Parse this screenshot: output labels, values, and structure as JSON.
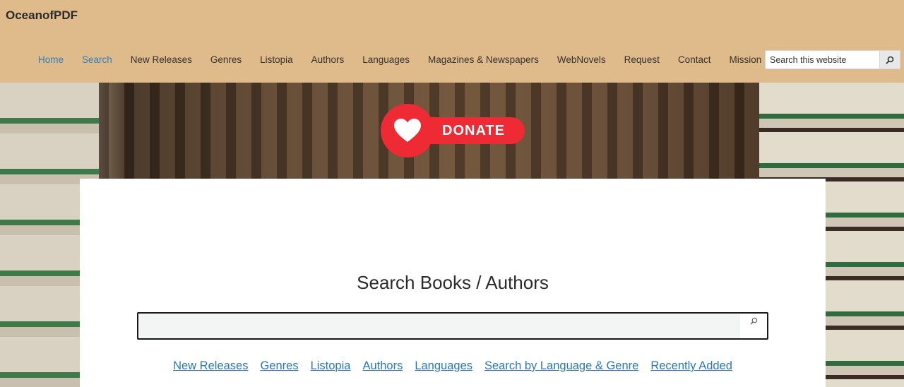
{
  "header": {
    "site_title": "OceanofPDF",
    "background_color": "#dfba8b",
    "nav": [
      {
        "label": "Home",
        "active": true
      },
      {
        "label": "Search",
        "active": true
      },
      {
        "label": "New Releases",
        "active": false
      },
      {
        "label": "Genres",
        "active": false
      },
      {
        "label": "Listopia",
        "active": false
      },
      {
        "label": "Authors",
        "active": false
      },
      {
        "label": "Languages",
        "active": false
      },
      {
        "label": "Magazines & Newspapers",
        "active": false
      },
      {
        "label": "WebNovels",
        "active": false
      },
      {
        "label": "Request",
        "active": false
      },
      {
        "label": "Contact",
        "active": false
      },
      {
        "label": "Mission",
        "active": false
      }
    ],
    "search": {
      "placeholder": "Search this website",
      "icon": "search-icon"
    }
  },
  "donate": {
    "label": "DONATE",
    "icon": "heart-icon",
    "color": "#ee2b34"
  },
  "main": {
    "title": "Search Books / Authors",
    "search": {
      "value": "",
      "icon": "search-icon"
    },
    "links": [
      "New Releases",
      "Genres",
      "Listopia",
      "Authors",
      "Languages",
      "Search by Language & Genre",
      "Recently Added"
    ],
    "link_color": "#2a78b3"
  }
}
